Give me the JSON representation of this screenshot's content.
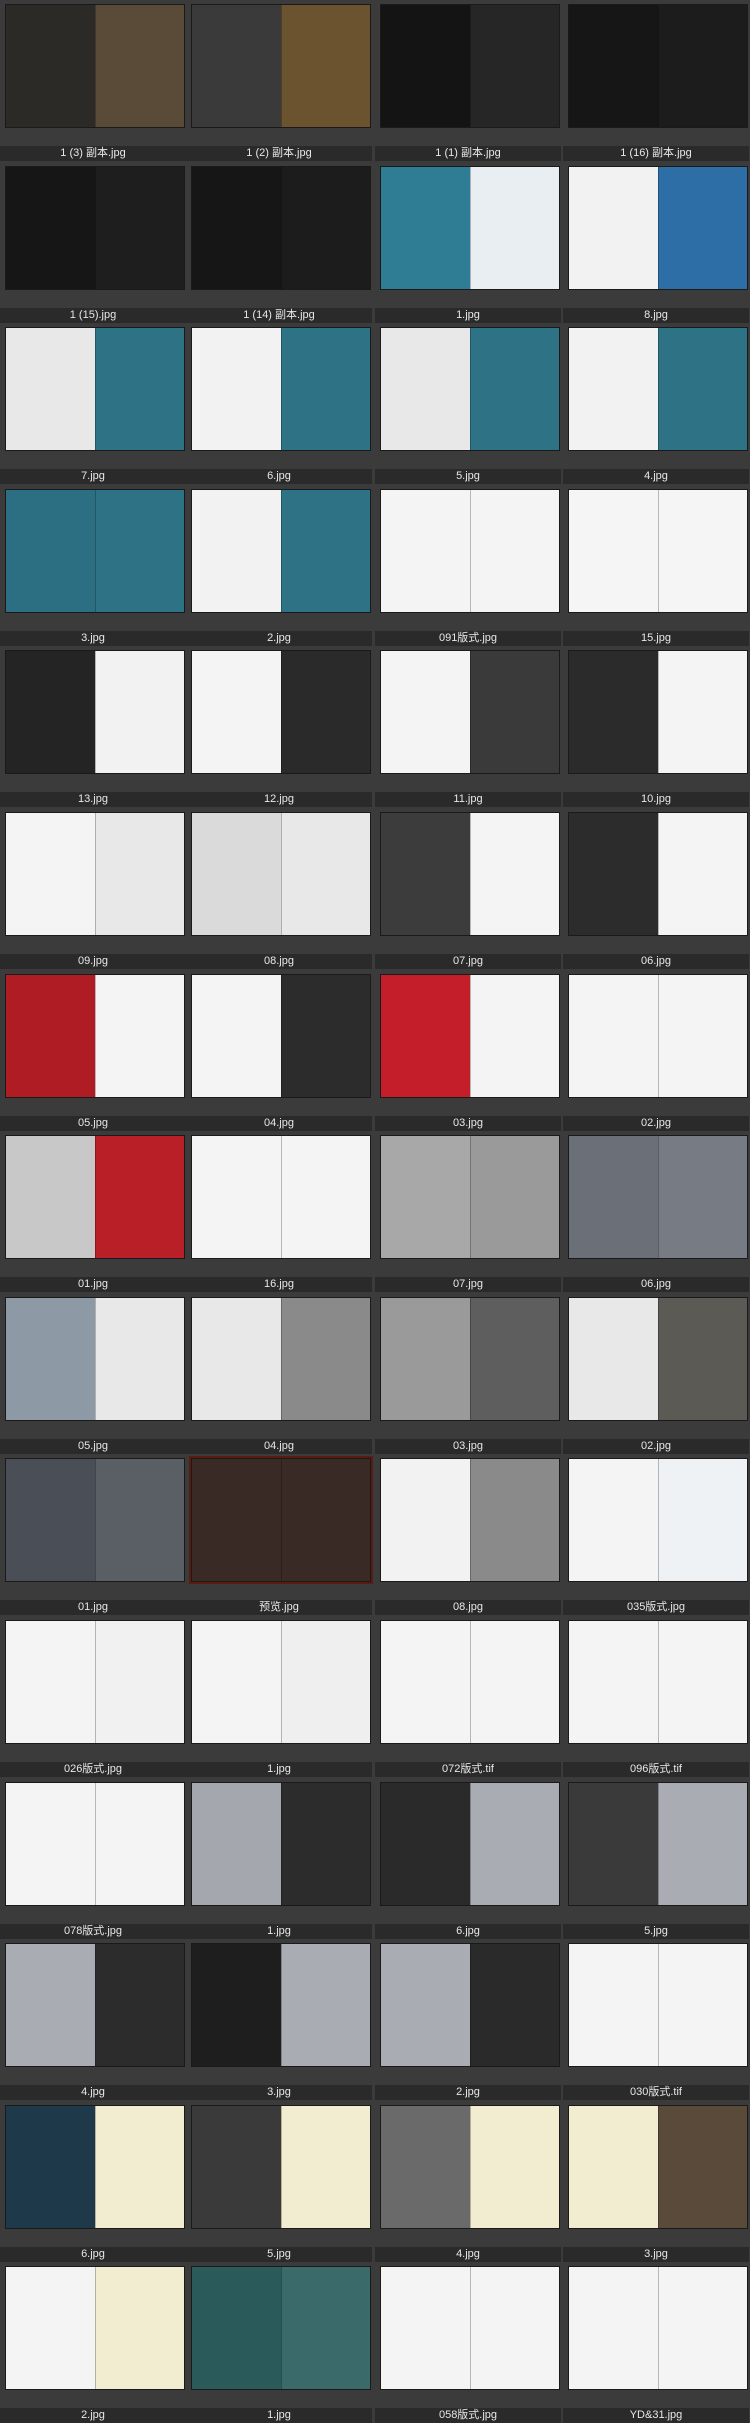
{
  "files": [
    {
      "label": "1 (3) 副本.jpg",
      "left": "#2c2a26",
      "right": "#5a4a38"
    },
    {
      "label": "1 (2) 副本.jpg",
      "left": "#3a3a3a",
      "right": "#6b5330"
    },
    {
      "label": "1 (1) 副本.jpg",
      "left": "#141414",
      "right": "#262626"
    },
    {
      "label": "1 (16) 副本.jpg",
      "left": "#161616",
      "right": "#1c1c1c"
    },
    {
      "label": "1 (15).jpg",
      "left": "#161616",
      "right": "#1e1e1e"
    },
    {
      "label": "1 (14) 副本.jpg",
      "left": "#161616",
      "right": "#1c1c1c"
    },
    {
      "label": "1.jpg",
      "left": "#2f7d95",
      "right": "#e9eef2"
    },
    {
      "label": "8.jpg",
      "left": "#f2f2f2",
      "right": "#2e6ea6"
    },
    {
      "label": "7.jpg",
      "left": "#e8e8e8",
      "right": "#2d7385"
    },
    {
      "label": "6.jpg",
      "left": "#f2f2f2",
      "right": "#2d7385"
    },
    {
      "label": "5.jpg",
      "left": "#e8e8e8",
      "right": "#2d7385"
    },
    {
      "label": "4.jpg",
      "left": "#f2f2f2",
      "right": "#2d7385"
    },
    {
      "label": "3.jpg",
      "left": "#2d6f82",
      "right": "#2d7385"
    },
    {
      "label": "2.jpg",
      "left": "#f2f2f2",
      "right": "#2d7385"
    },
    {
      "label": "091版式.jpg",
      "left": "#f4f4f4",
      "right": "#f4f4f4"
    },
    {
      "label": "15.jpg",
      "left": "#f5f5f5",
      "right": "#f5f5f5"
    },
    {
      "label": "13.jpg",
      "left": "#242424",
      "right": "#f2f2f2"
    },
    {
      "label": "12.jpg",
      "left": "#f4f4f4",
      "right": "#2a2a2a"
    },
    {
      "label": "11.jpg",
      "left": "#f4f4f4",
      "right": "#3a3a3a"
    },
    {
      "label": "10.jpg",
      "left": "#2b2b2b",
      "right": "#f4f4f4"
    },
    {
      "label": "09.jpg",
      "left": "#f4f4f4",
      "right": "#e8e8e8"
    },
    {
      "label": "08.jpg",
      "left": "#dadada",
      "right": "#e8e8e8"
    },
    {
      "label": "07.jpg",
      "left": "#3c3c3c",
      "right": "#f4f4f4"
    },
    {
      "label": "06.jpg",
      "left": "#2c2c2c",
      "right": "#f4f4f4"
    },
    {
      "label": "05.jpg",
      "left": "#b01c24",
      "right": "#f4f4f4"
    },
    {
      "label": "04.jpg",
      "left": "#f4f4f4",
      "right": "#2c2c2c"
    },
    {
      "label": "03.jpg",
      "left": "#c41e2b",
      "right": "#f4f4f4"
    },
    {
      "label": "02.jpg",
      "left": "#f4f4f4",
      "right": "#f4f4f4"
    },
    {
      "label": "01.jpg",
      "left": "#c8c8c8",
      "right": "#b81f26"
    },
    {
      "label": "16.jpg",
      "left": "#f4f4f4",
      "right": "#f4f4f4"
    },
    {
      "label": "07.jpg",
      "left": "#a8a8a8",
      "right": "#9a9a9a"
    },
    {
      "label": "06.jpg",
      "left": "#6a6f78",
      "right": "#777c84"
    },
    {
      "label": "05.jpg",
      "left": "#8d9aa6",
      "right": "#e8e8e8"
    },
    {
      "label": "04.jpg",
      "left": "#e8e8e8",
      "right": "#8a8a8a"
    },
    {
      "label": "03.jpg",
      "left": "#9a9a9a",
      "right": "#5e5e5e"
    },
    {
      "label": "02.jpg",
      "left": "#e8e8e8",
      "right": "#5c5a55"
    },
    {
      "label": "01.jpg",
      "left": "#4a4f57",
      "right": "#5a5f66"
    },
    {
      "label": "预览.jpg",
      "left": "#3a2a26",
      "right": "#3a2a26"
    },
    {
      "label": "08.jpg",
      "left": "#f2f2f2",
      "right": "#8a8a8a"
    },
    {
      "label": "035版式.jpg",
      "left": "#f4f4f4",
      "right": "#eef2f4"
    },
    {
      "label": "026版式.jpg",
      "left": "#f4f4f4",
      "right": "#f1f1f1"
    },
    {
      "label": "1.jpg",
      "left": "#f4f4f4",
      "right": "#efefef"
    },
    {
      "label": "072版式.tif",
      "left": "#f4f4f4",
      "right": "#f4f4f4"
    },
    {
      "label": "096版式.tif",
      "left": "#f4f4f4",
      "right": "#f4f4f4"
    },
    {
      "label": "078版式.jpg",
      "left": "#f4f4f4",
      "right": "#f4f4f4"
    },
    {
      "label": "1.jpg",
      "left": "#a4a8ae",
      "right": "#2c2c2c"
    },
    {
      "label": "6.jpg",
      "left": "#2a2a2a",
      "right": "#a9adb3"
    },
    {
      "label": "5.jpg",
      "left": "#3a3a3a",
      "right": "#a9adb3"
    },
    {
      "label": "4.jpg",
      "left": "#a9adb3",
      "right": "#2c2c2c"
    },
    {
      "label": "3.jpg",
      "left": "#1e1e1e",
      "right": "#a9adb3"
    },
    {
      "label": "2.jpg",
      "left": "#a9adb3",
      "right": "#2a2a2a"
    },
    {
      "label": "030版式.tif",
      "left": "#f4f4f4",
      "right": "#f4f4f4"
    },
    {
      "label": "6.jpg",
      "left": "#1e3a4a",
      "right": "#f2ecd0"
    },
    {
      "label": "5.jpg",
      "left": "#3a3a3a",
      "right": "#f2ecd0"
    },
    {
      "label": "4.jpg",
      "left": "#6a6a6a",
      "right": "#f2ecd0"
    },
    {
      "label": "3.jpg",
      "left": "#f2ecd0",
      "right": "#5a4a3a"
    },
    {
      "label": "2.jpg",
      "left": "#f4f4f4",
      "right": "#f2ecd0"
    },
    {
      "label": "1.jpg",
      "left": "#2a5a5a",
      "right": "#3a6a6a"
    },
    {
      "label": "058版式.jpg",
      "left": "#f4f4f4",
      "right": "#f4f4f4"
    },
    {
      "label": "YD&31.jpg",
      "left": "#f4f4f4",
      "right": "#f4f4f4"
    }
  ]
}
